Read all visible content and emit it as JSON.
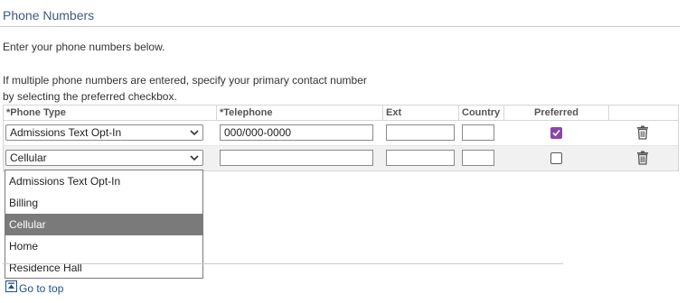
{
  "section": {
    "title": "Phone Numbers",
    "intro": "Enter your phone numbers below.",
    "hint_line1": "If multiple phone numbers are entered, specify your primary contact number",
    "hint_line2": "by selecting the preferred checkbox."
  },
  "grid": {
    "headers": {
      "phone_type": "*Phone Type",
      "telephone": "*Telephone",
      "ext": "Ext",
      "country": "Country",
      "preferred": "Preferred"
    },
    "rows": [
      {
        "phone_type": "Admissions Text Opt-In",
        "telephone": "000/000-0000",
        "ext": "",
        "country": "",
        "preferred": true
      },
      {
        "phone_type": "Cellular",
        "telephone": "",
        "ext": "",
        "country": "",
        "preferred": false
      }
    ]
  },
  "dropdown": {
    "options": [
      "Admissions Text Opt-In",
      "Billing",
      "Cellular",
      "Home",
      "Residence Hall"
    ],
    "selected": "Cellular"
  },
  "footer": {
    "goto_top": "Go to top"
  },
  "colors": {
    "title": "#3d5a80",
    "checkbox_checked": "#8e44ad",
    "dropdown_selected_bg": "#7a7a7a",
    "link": "#1f4e8c"
  },
  "icons": {
    "delete": "trash-icon",
    "select": "chevron-down-icon",
    "go_top": "arrow-up-box-icon"
  }
}
